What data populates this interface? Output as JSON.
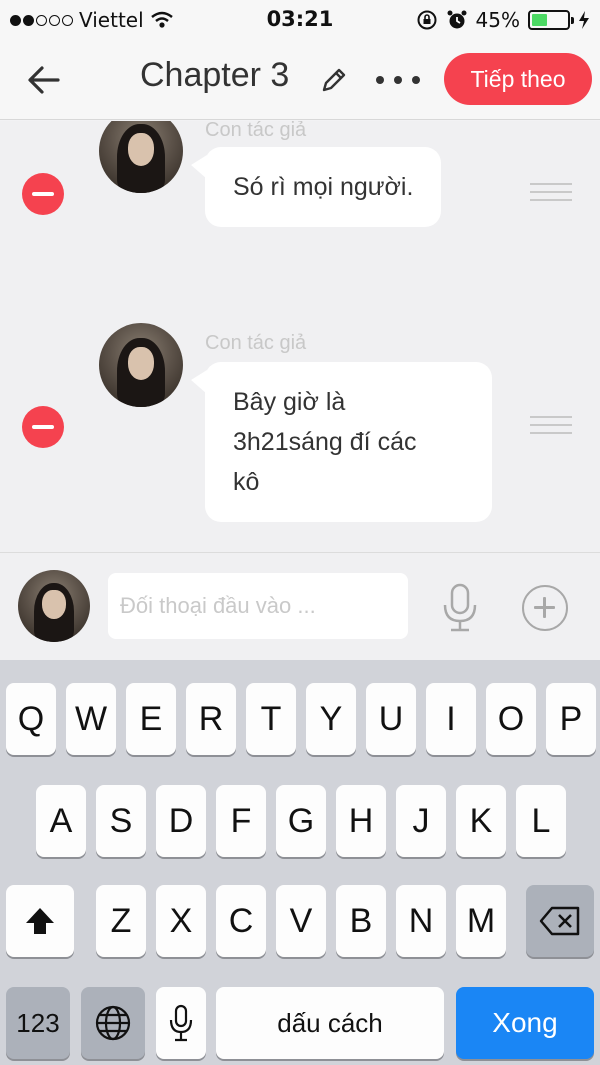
{
  "status_bar": {
    "carrier": "Viettel",
    "time": "03:21",
    "battery_pct": "45%",
    "battery_level": 0.45,
    "battery_color": "#4cd964"
  },
  "header": {
    "title": "Chapter 3",
    "next_label": "Tiếp theo",
    "accent_color": "#f5424f"
  },
  "messages": [
    {
      "author": "Con tác giả",
      "text": "Só rì mọi người."
    },
    {
      "author": "Con tác giả",
      "text_lines": [
        "Bây giờ là",
        "3h21sáng đí các",
        "kô"
      ]
    }
  ],
  "composer": {
    "placeholder": "Đối thoại đầu vào ..."
  },
  "keyboard": {
    "row1": [
      "Q",
      "W",
      "E",
      "R",
      "T",
      "Y",
      "U",
      "I",
      "O",
      "P"
    ],
    "row2": [
      "A",
      "S",
      "D",
      "F",
      "G",
      "H",
      "J",
      "K",
      "L"
    ],
    "row3": [
      "Z",
      "X",
      "C",
      "V",
      "B",
      "N",
      "M"
    ],
    "numbers_label": "123",
    "space_label": "dấu cách",
    "done_label": "Xong"
  },
  "icons": {
    "back": "arrow-left-icon",
    "edit": "pencil-icon",
    "more": "ellipsis-icon",
    "remove": "minus-circle-icon",
    "drag": "drag-handle-icon",
    "mic": "microphone-icon",
    "add": "plus-circle-icon",
    "shift": "shift-icon",
    "delete": "backspace-icon",
    "globe": "globe-icon"
  }
}
